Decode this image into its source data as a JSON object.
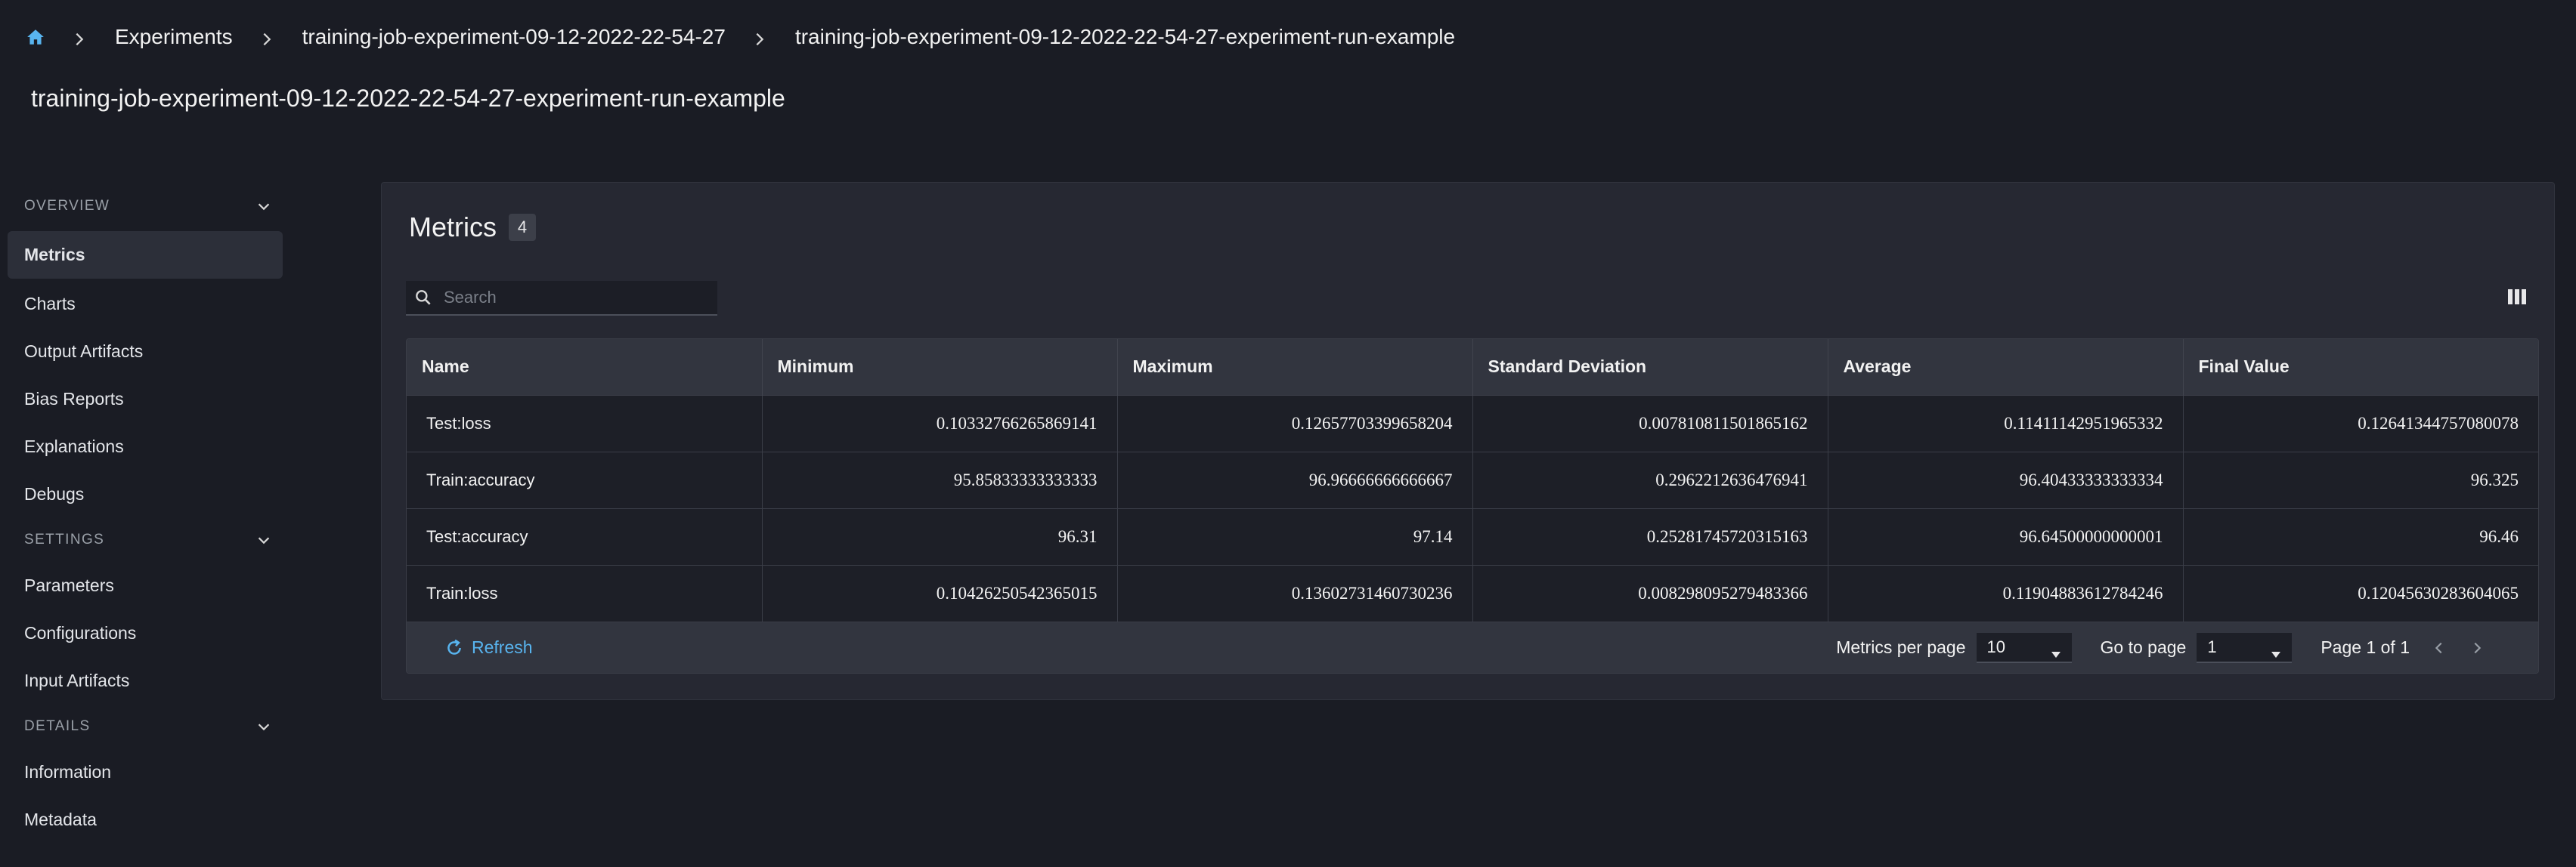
{
  "breadcrumb": {
    "items": [
      "Experiments",
      "training-job-experiment-09-12-2022-22-54-27",
      "training-job-experiment-09-12-2022-22-54-27-experiment-run-example"
    ]
  },
  "page": {
    "title": "training-job-experiment-09-12-2022-22-54-27-experiment-run-example"
  },
  "sidebar": {
    "sections": [
      {
        "label": "OVERVIEW",
        "items": [
          "Metrics",
          "Charts",
          "Output Artifacts",
          "Bias Reports",
          "Explanations",
          "Debugs"
        ]
      },
      {
        "label": "SETTINGS",
        "items": [
          "Parameters",
          "Configurations",
          "Input Artifacts"
        ]
      },
      {
        "label": "DETAILS",
        "items": [
          "Information",
          "Metadata"
        ]
      }
    ],
    "active": "Metrics"
  },
  "metrics": {
    "title": "Metrics",
    "count": "4",
    "search_placeholder": "Search",
    "columns": [
      "Name",
      "Minimum",
      "Maximum",
      "Standard Deviation",
      "Average",
      "Final Value"
    ],
    "rows": [
      [
        "Test:loss",
        "0.10332766265869141",
        "0.12657703399658204",
        "0.007810811501865162",
        "0.11411142951965332",
        "0.12641344757080078"
      ],
      [
        "Train:accuracy",
        "95.85833333333333",
        "96.96666666666667",
        "0.2962212636476941",
        "96.40433333333334",
        "96.325"
      ],
      [
        "Test:accuracy",
        "96.31",
        "97.14",
        "0.25281745720315163",
        "96.64500000000001",
        "96.46"
      ],
      [
        "Train:loss",
        "0.10426250542365015",
        "0.13602731460730236",
        "0.008298095279483366",
        "0.11904883612784246",
        "0.12045630283604065"
      ]
    ],
    "refresh_label": "Refresh",
    "per_page_label": "Metrics per page",
    "per_page_value": "10",
    "goto_label": "Go to page",
    "goto_value": "1",
    "page_info": "Page 1 of 1"
  },
  "colors": {
    "background": "#1a1c24",
    "panel": "#262832",
    "accent": "#58b4ef"
  },
  "icons": [
    "home-icon",
    "chevron-right-icon",
    "chevron-down-icon",
    "search-icon",
    "columns-icon",
    "refresh-icon",
    "caret-down-icon",
    "chevron-left-icon"
  ]
}
